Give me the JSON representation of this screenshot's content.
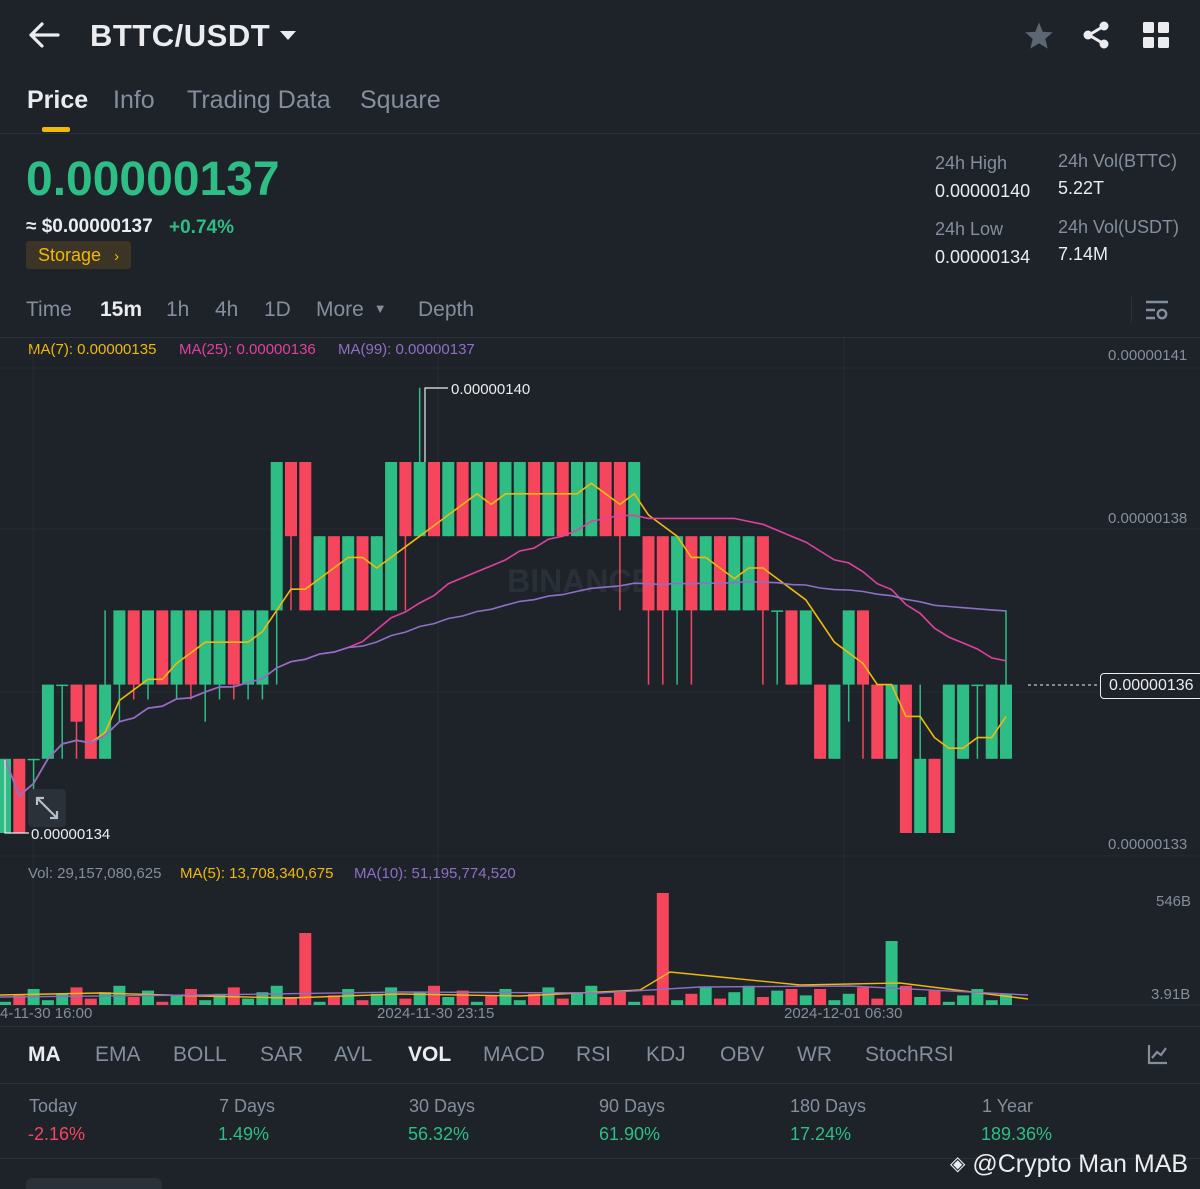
{
  "header": {
    "pair": "BTTC/USDT",
    "icons": [
      "back-arrow-icon",
      "caret-down-icon",
      "star-icon",
      "share-icon",
      "grid-icon"
    ]
  },
  "tabs": [
    "Price",
    "Info",
    "Trading Data",
    "Square"
  ],
  "ticker": {
    "last_price": "0.00000137",
    "usd_price": "≈ $0.00000137",
    "change": "+0.74%",
    "tag": "Storage",
    "high_label": "24h High",
    "high_value": "0.00000140",
    "low_label": "24h Low",
    "low_value": "0.00000134",
    "vol_base_label": "24h Vol(BTTC)",
    "vol_base_value": "5.22T",
    "vol_quote_label": "24h Vol(USDT)",
    "vol_quote_value": "7.14M"
  },
  "timeframes": [
    "Time",
    "15m",
    "1h",
    "4h",
    "1D",
    "More",
    "Depth"
  ],
  "chart": {
    "ma7": "MA(7): 0.00000135",
    "ma25": "MA(25): 0.00000136",
    "ma99": "MA(99): 0.00000137",
    "y_labels": [
      "0.00000141",
      "0.00000138",
      "0.00000133"
    ],
    "current_price": "0.00000136",
    "high_marker": "0.00000140",
    "low_marker": "0.00000134",
    "vol": "Vol: 29,157,080,625",
    "vol_ma5": "MA(5): 13,708,340,675",
    "vol_ma10": "MA(10): 51,195,774,520",
    "vol_y_labels": [
      "546B",
      "3.91B"
    ],
    "x_labels": [
      "4-11-30 16:00",
      "2024-11-30 23:15",
      "2024-12-01 06:30"
    ],
    "watermark": "BINANCE",
    "colors": {
      "up": "#2ebd85",
      "down": "#f6465d",
      "ma7": "#f0b90b",
      "ma25": "#e040a0",
      "ma99": "#8e6fc7"
    }
  },
  "indicators": [
    "MA",
    "EMA",
    "BOLL",
    "SAR",
    "AVL",
    "VOL",
    "MACD",
    "RSI",
    "KDJ",
    "OBV",
    "WR",
    "StochRSI"
  ],
  "performance": [
    {
      "label": "Today",
      "value": "-2.16%"
    },
    {
      "label": "7 Days",
      "value": "1.49%"
    },
    {
      "label": "30 Days",
      "value": "56.32%"
    },
    {
      "label": "90 Days",
      "value": "61.90%"
    },
    {
      "label": "180 Days",
      "value": "17.24%"
    },
    {
      "label": "1 Year",
      "value": "189.36%"
    }
  ],
  "footer": {
    "credit": "@Crypto Man MAB"
  }
}
